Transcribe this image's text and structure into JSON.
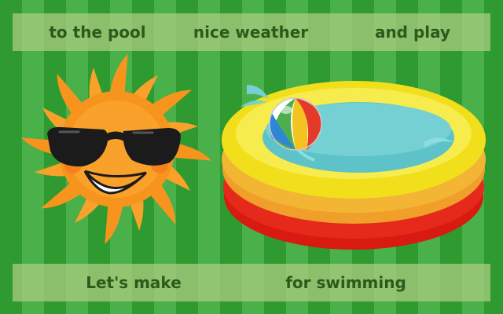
{
  "top_words": [
    "to the pool",
    "nice weather",
    "and play"
  ],
  "bottom_words": [
    "Let's make",
    "for swimming"
  ],
  "colors": {
    "stripe_dark": "#2f9a2f",
    "stripe_light": "#4ab04a",
    "bar": "#afcd82",
    "text": "#2d5a1b",
    "sun": "#f7941d",
    "pool_yellow": "#f0e020",
    "pool_red": "#e02418",
    "water": "#5ec3c9"
  },
  "icons": [
    "sun-with-sunglasses-icon",
    "paddling-pool-icon",
    "beach-ball-icon"
  ]
}
